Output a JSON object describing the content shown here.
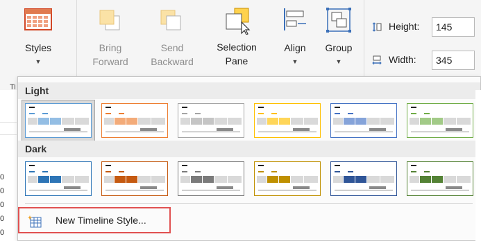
{
  "ribbon": {
    "styles_label": "Styles",
    "bring_forward_label": "Bring Forward",
    "send_backward_label": "Send Backward",
    "selection_pane_label": "Selection Pane",
    "align_label": "Align",
    "group_label": "Group",
    "height_label": "Height:",
    "height_value": "145",
    "width_label": "Width:",
    "width_value": "345",
    "tab_peek": "Ti"
  },
  "gallery": {
    "light_header": "Light",
    "dark_header": "Dark",
    "new_style_label": "New Timeline Style...",
    "light_colors": [
      "#5b9bd5",
      "#ed7d31",
      "#a5a5a5",
      "#ffc000",
      "#4472c4",
      "#70ad47"
    ],
    "dark_colors": [
      "#2e75b6",
      "#c55a11",
      "#7b7b7b",
      "#bf9000",
      "#2f5597",
      "#548235"
    ]
  },
  "sheet": {
    "row_labels": [
      "0",
      "0",
      "0",
      "0",
      "0",
      "0"
    ]
  }
}
